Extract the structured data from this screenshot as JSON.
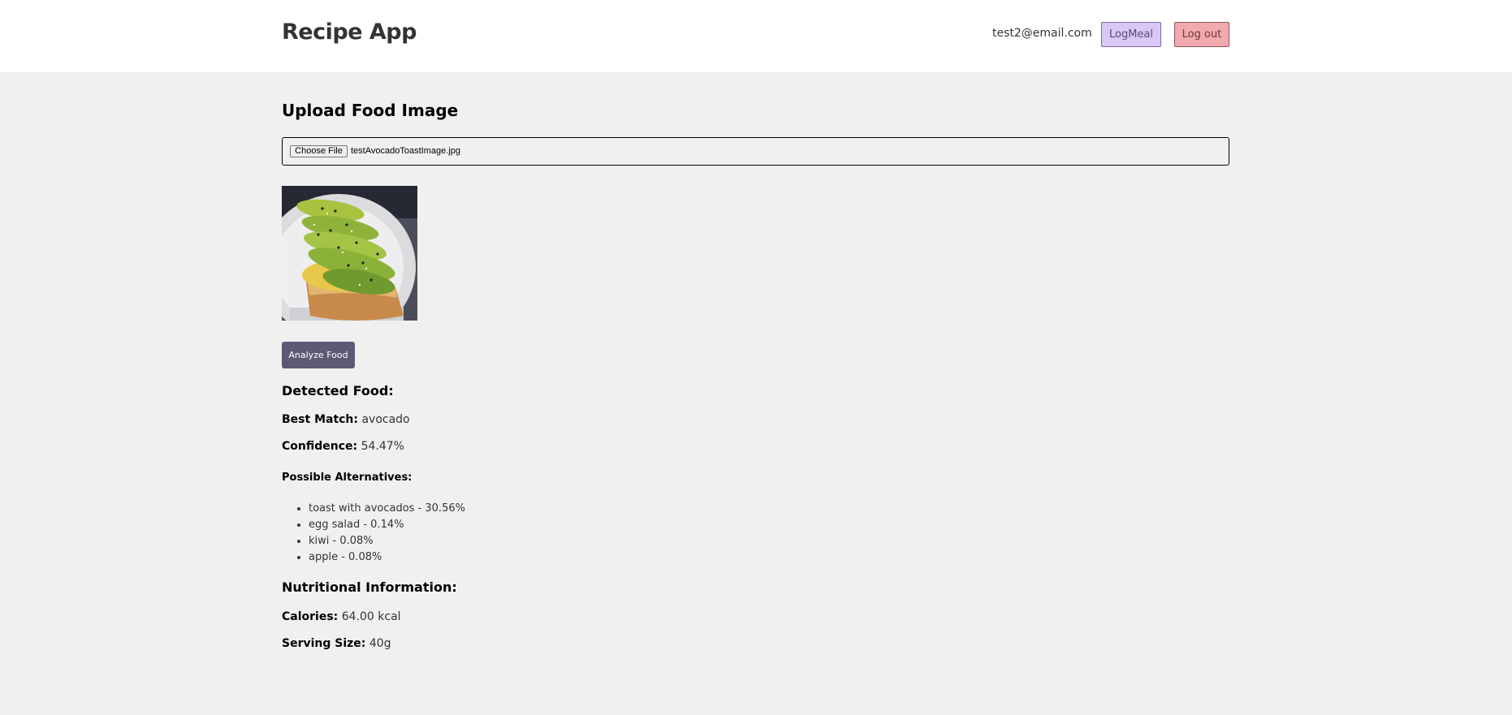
{
  "header": {
    "app_title": "Recipe App",
    "user_email": "test2@email.com",
    "logmeal_label": "LogMeal",
    "logout_label": "Log out"
  },
  "upload": {
    "title": "Upload Food Image",
    "choose_file_label": "Choose File",
    "file_name": "testAvocadoToastImage.jpg"
  },
  "actions": {
    "analyze_label": "Analyze Food"
  },
  "detected": {
    "heading": "Detected Food:",
    "best_match_label": "Best Match:",
    "best_match_value": "avocado",
    "confidence_label": "Confidence:",
    "confidence_value": "54.47%",
    "alternatives_heading": "Possible Alternatives:",
    "alternatives": [
      "toast with avocados - 30.56%",
      "egg salad - 0.14%",
      "kiwi - 0.08%",
      "apple - 0.08%"
    ]
  },
  "nutrition": {
    "heading": "Nutritional Information:",
    "calories_label": "Calories:",
    "calories_value": "64.00 kcal",
    "serving_label": "Serving Size:",
    "serving_value": "40g"
  },
  "colors": {
    "page_bg": "#f0f0f0",
    "header_bg": "#ffffff",
    "logmeal_bg": "#d9c8f7",
    "logout_bg": "#f2aaae",
    "analyze_bg": "#5e5875"
  }
}
